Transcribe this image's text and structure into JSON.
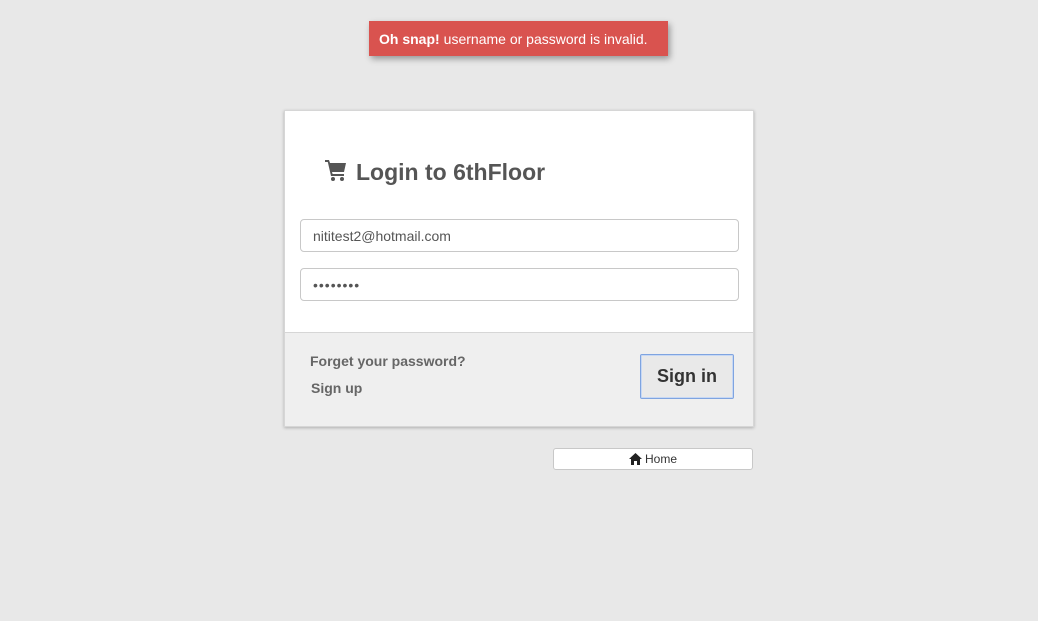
{
  "alert": {
    "strong": "Oh snap!",
    "message": "username or password is invalid.",
    "color": "#d9534f"
  },
  "login": {
    "icon": "shopping-cart-icon",
    "title": "Login to 6thFloor",
    "email_value": "nititest2@hotmail.com",
    "password_value": "12345678",
    "forgot_label": "Forget your password?",
    "signup_label": "Sign up",
    "signin_label": "Sign in"
  },
  "home": {
    "icon": "home-icon",
    "label": "Home"
  }
}
